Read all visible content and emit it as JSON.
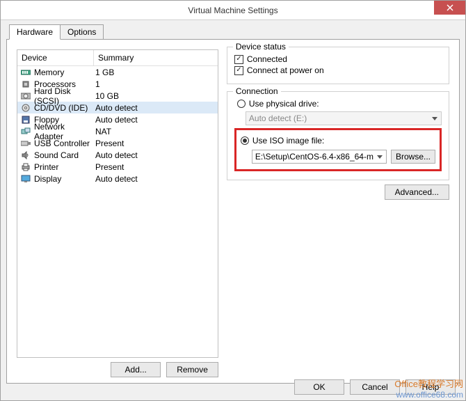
{
  "title": "Virtual Machine Settings",
  "tabs": {
    "hardware": "Hardware",
    "options": "Options"
  },
  "columns": {
    "device": "Device",
    "summary": "Summary"
  },
  "devices": [
    {
      "name": "Memory",
      "summary": "1 GB"
    },
    {
      "name": "Processors",
      "summary": "1"
    },
    {
      "name": "Hard Disk (SCSI)",
      "summary": "10 GB"
    },
    {
      "name": "CD/DVD (IDE)",
      "summary": "Auto detect"
    },
    {
      "name": "Floppy",
      "summary": "Auto detect"
    },
    {
      "name": "Network Adapter",
      "summary": "NAT"
    },
    {
      "name": "USB Controller",
      "summary": "Present"
    },
    {
      "name": "Sound Card",
      "summary": "Auto detect"
    },
    {
      "name": "Printer",
      "summary": "Present"
    },
    {
      "name": "Display",
      "summary": "Auto detect"
    }
  ],
  "buttons": {
    "add": "Add...",
    "remove": "Remove",
    "ok": "OK",
    "cancel": "Cancel",
    "help": "Help",
    "browse": "Browse...",
    "advanced": "Advanced..."
  },
  "status": {
    "title": "Device status",
    "connected": "Connected",
    "connect_power": "Connect at power on"
  },
  "connection": {
    "title": "Connection",
    "physical": "Use physical drive:",
    "physical_value": "Auto detect (E:)",
    "iso": "Use ISO image file:",
    "iso_value": "E:\\Setup\\CentOS-6.4-x86_64-m"
  },
  "watermark": {
    "line1": "Office教程学习网",
    "line2": "www.office68.com"
  }
}
